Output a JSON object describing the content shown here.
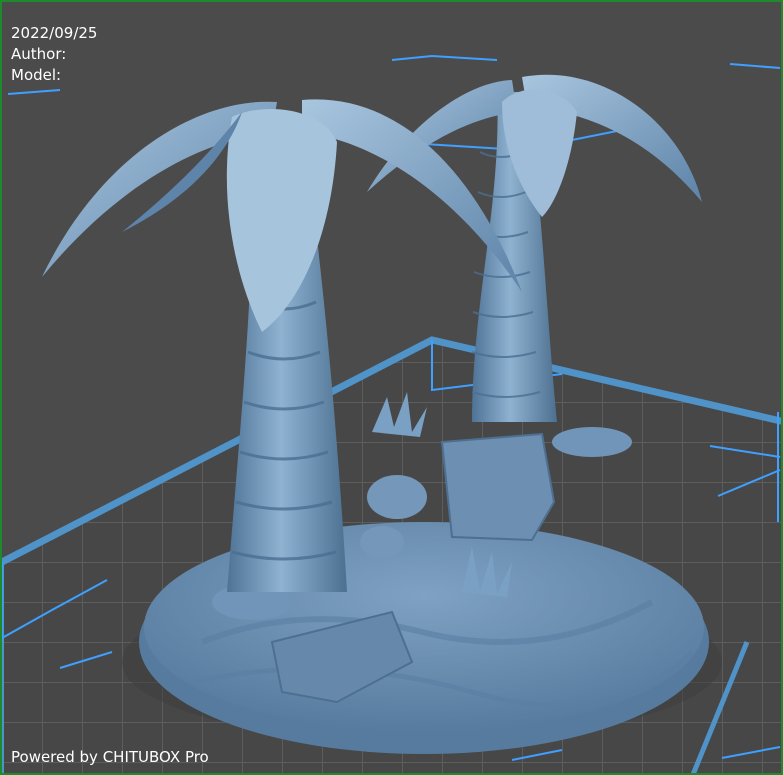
{
  "overlay": {
    "date": "2022/09/25",
    "author_label": "Author:",
    "model_label": "Model:",
    "footer": "Powered by CHITUBOX Pro"
  },
  "colors": {
    "background": "#4b4b4b",
    "grid": "#5d5d5d",
    "platform_edge": "#4f93c9",
    "bounding_box": "#3fa0ff",
    "model": "#6d93b8",
    "window_border": "#1f8a2c"
  },
  "scene": {
    "model_description_icon": "palm-trees-on-oval-base-model"
  }
}
